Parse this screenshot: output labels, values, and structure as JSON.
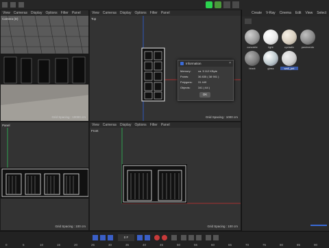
{
  "vp_menu": [
    "View",
    "Cameras",
    "Display",
    "Options",
    "Filter",
    "Panel"
  ],
  "right_menu": [
    "Create",
    "V-Ray",
    "Cinema",
    "Edit",
    "View",
    "Select"
  ],
  "viewport_tl": {
    "label": "Camera (D)",
    "grid": "Grid Spacing : 10000 cm"
  },
  "viewport_tr": {
    "label": "Top",
    "grid": "Grid Spacing : 1000 cm"
  },
  "viewport_bl": {
    "label": "Panel",
    "grid": "Grid Spacing : 100 cm"
  },
  "viewport_br": {
    "label": "Front",
    "grid": "Grid Spacing : 100 cm"
  },
  "dialog": {
    "title": "Information",
    "rows": [
      {
        "label": "Memory:",
        "value": "ca. 5 112 KByte"
      },
      {
        "label": "Points:",
        "value": "36 835 ( 38 901 )"
      },
      {
        "label": "Polygons:",
        "value": "31 449"
      },
      {
        "label": "Objects:",
        "value": "341 ( 64 )"
      }
    ],
    "ok": "OK"
  },
  "materials": [
    {
      "name": "concrete",
      "color": "#9a9a9a"
    },
    {
      "name": "light",
      "color": "#e8e8e8"
    },
    {
      "name": "cycladic",
      "color": "#d8cfc0"
    },
    {
      "name": "pavimento",
      "color": "#8a8a8a"
    },
    {
      "name": "black",
      "color": "#7a7a7a"
    },
    {
      "name": "glass",
      "color": "#bcc8cc"
    },
    {
      "name": "wall_pnt",
      "color": "#cfcfcf"
    }
  ],
  "timeline": {
    "frame": "0 F",
    "ticks": [
      "0",
      "5",
      "10",
      "15",
      "20",
      "25",
      "30",
      "35",
      "40",
      "45",
      "50",
      "55",
      "60",
      "65",
      "70",
      "75",
      "80",
      "85",
      "90"
    ]
  },
  "colors": {
    "accent_green": "#2bd44f",
    "axis_blue": "#2f65e0",
    "axis_red": "#d23030",
    "axis_green": "#2fbf5a"
  }
}
